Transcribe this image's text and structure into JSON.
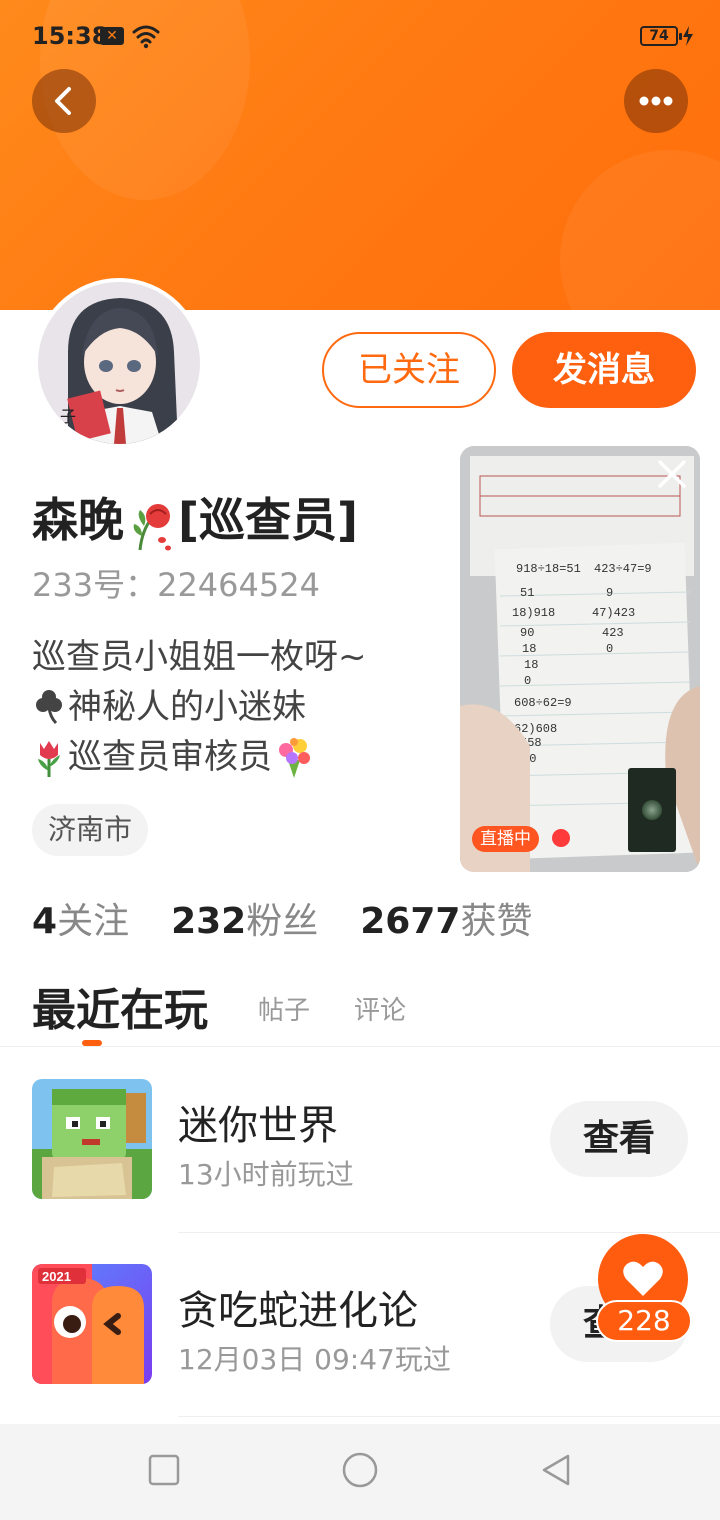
{
  "status_bar": {
    "time": "15:38",
    "notification_icon": "x-app-icon",
    "wifi_icon": "wifi-icon",
    "battery": "74",
    "charging_icon": "charging-bolt-icon"
  },
  "header": {
    "back_icon": "back-chevron-icon",
    "more_icon": "more-dots-icon",
    "colors": {
      "header_start": "#ff8a1c",
      "header_end": "#ff6e0c"
    }
  },
  "profile": {
    "avatar_icon": "user-avatar",
    "nickname": "森晚",
    "nickname_emoji": "wilted-rose-emoji",
    "title_badge": "[巡查员]",
    "uid": "233号：22464524",
    "bio": {
      "line1": "巡查员小姐姐一枚呀~",
      "line2_emoji": "shamrock-emoji",
      "line2": "神秘人的小迷妹",
      "line3_emoji": "tulip-emoji",
      "line3": "巡查员审核员",
      "line3_emoji_end": "bouquet-emoji"
    },
    "location": "济南市"
  },
  "actions": {
    "followed_label": "已关注",
    "message_label": "发消息",
    "accent_color": "#ff6010"
  },
  "live_card": {
    "badge": "直播中",
    "close_icon": "close-icon"
  },
  "stats": [
    {
      "num": "4",
      "label": "关注"
    },
    {
      "num": "232",
      "label": "粉丝"
    },
    {
      "num": "2677",
      "label": "获赞"
    }
  ],
  "tabs": {
    "active": "最近在玩",
    "posts": "帖子",
    "comments": "评论"
  },
  "games": [
    {
      "name": "迷你世界",
      "time": "13小时前玩过",
      "button": "查看",
      "icon": "mini-world-game-icon"
    },
    {
      "name": "贪吃蛇进化论",
      "time": "12月03日 09:47玩过",
      "button": "查看",
      "icon": "snake-game-icon",
      "icon_badge": "2021"
    }
  ],
  "like_fab": {
    "icon": "heart-icon",
    "count": "228"
  },
  "nav_bar": {
    "recent_icon": "square-icon",
    "home_icon": "circle-icon",
    "back_icon": "triangle-back-icon"
  }
}
